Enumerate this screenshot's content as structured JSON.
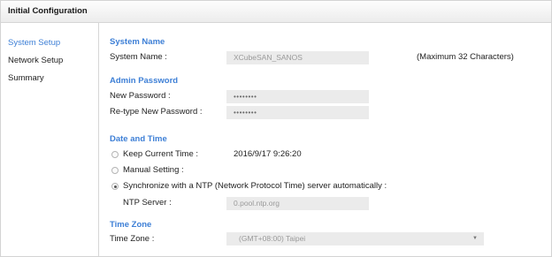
{
  "window": {
    "title": "Initial Configuration"
  },
  "sidebar": {
    "items": [
      {
        "label": "System Setup",
        "active": true
      },
      {
        "label": "Network Setup",
        "active": false
      },
      {
        "label": "Summary",
        "active": false
      }
    ]
  },
  "system_name": {
    "section_title": "System Name",
    "label": "System Name :",
    "value": "XCubeSAN_SANOS",
    "hint": "(Maximum 32 Characters)"
  },
  "admin_password": {
    "section_title": "Admin Password",
    "new_label": "New Password :",
    "new_value": "••••••••",
    "retype_label": "Re-type New Password :",
    "retype_value": "••••••••"
  },
  "date_time": {
    "section_title": "Date and Time",
    "options": [
      {
        "label": "Keep Current Time :",
        "checked": false
      },
      {
        "label": "Manual Setting :",
        "checked": false
      },
      {
        "label": "Synchronize with a NTP (Network Protocol Time) server automatically :",
        "checked": true
      }
    ],
    "current_time": "2016/9/17 9:26:20",
    "ntp_label": "NTP Server :",
    "ntp_value": "0.pool.ntp.org"
  },
  "time_zone": {
    "section_title": "Time Zone",
    "label": "Time Zone :",
    "selected": "(GMT+08:00) Taipei"
  },
  "colors": {
    "accent": "#3d7fd6",
    "field_bg": "#ebebeb",
    "border": "#d6d6d6"
  }
}
